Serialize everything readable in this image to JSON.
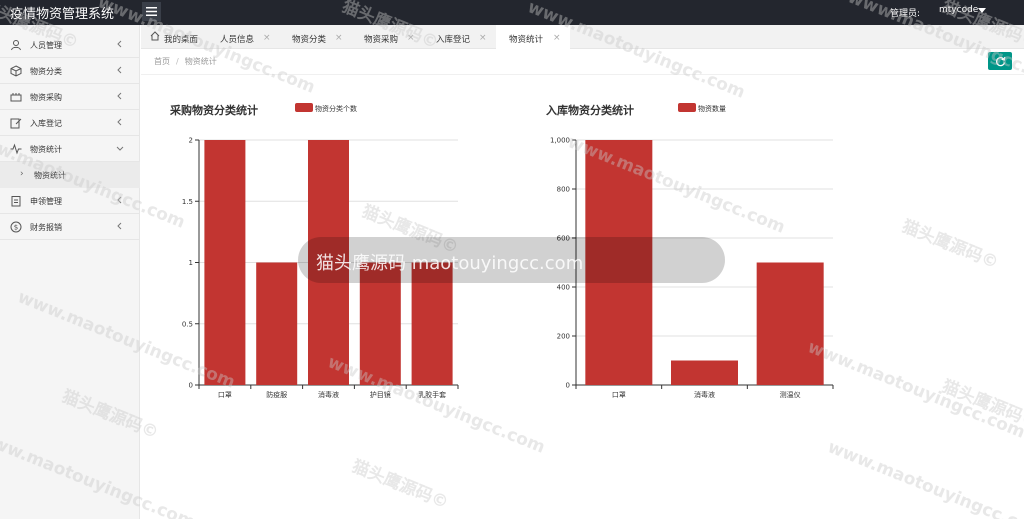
{
  "header": {
    "app_title": "疫情物资管理系统",
    "admin_label": "管理员:",
    "admin_user": "mtycode"
  },
  "sidebar": {
    "items": [
      {
        "label": "人员管理",
        "icon": "user-icon"
      },
      {
        "label": "物资分类",
        "icon": "box-icon"
      },
      {
        "label": "物资采购",
        "icon": "cart-icon"
      },
      {
        "label": "入库登记",
        "icon": "edit-icon"
      },
      {
        "label": "物资统计",
        "icon": "pulse-icon"
      },
      {
        "label": "申领管理",
        "icon": "clipboard-icon"
      },
      {
        "label": "财务报销",
        "icon": "dollar-icon"
      }
    ],
    "sub_item": {
      "label": "物资统计"
    }
  },
  "tabs": [
    {
      "label": "我的桌面",
      "closable": false
    },
    {
      "label": "人员信息",
      "closable": true
    },
    {
      "label": "物资分类",
      "closable": true
    },
    {
      "label": "物资采购",
      "closable": true
    },
    {
      "label": "入库登记",
      "closable": true
    },
    {
      "label": "物资统计",
      "closable": true,
      "active": true
    }
  ],
  "breadcrumb": {
    "home": "首页",
    "separator": "/",
    "current": "物资统计"
  },
  "colors": {
    "bar": "#c23531",
    "topbar": "#23262e",
    "refresh": "#009688"
  },
  "chart_data": [
    {
      "type": "bar",
      "title": "采购物资分类统计",
      "legend": "物资分类个数",
      "categories": [
        "口罩",
        "防疫服",
        "消毒液",
        "护目镜",
        "乳胶手套"
      ],
      "series": [
        {
          "name": "物资分类个数",
          "values": [
            2,
            1,
            2,
            1,
            1
          ]
        }
      ],
      "ylim": [
        0,
        2
      ],
      "yticks": [
        "0",
        "0.5",
        "1",
        "1.5",
        "2"
      ]
    },
    {
      "type": "bar",
      "title": "入库物资分类统计",
      "legend": "物资数量",
      "categories": [
        "口罩",
        "消毒液",
        "测温仪"
      ],
      "series": [
        {
          "name": "物资数量",
          "values": [
            1000,
            100,
            500
          ]
        }
      ],
      "ylim": [
        0,
        1000
      ],
      "yticks": [
        "0",
        "200",
        "400",
        "600",
        "800",
        "1,000"
      ]
    }
  ],
  "watermark": {
    "text_cn": "猫头鹰源码©",
    "text_en": "www.maotouyingcc.com"
  },
  "toast": {
    "text": "猫头鹰源码 maotouyingcc.com"
  }
}
